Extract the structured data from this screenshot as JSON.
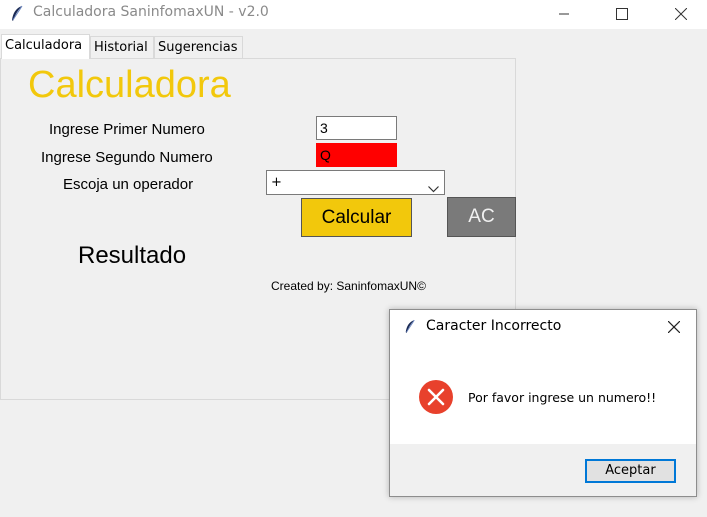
{
  "window": {
    "title": "Calculadora SaninfomaxUN - v2.0",
    "controls": {
      "minimize_icon": "minimize-icon",
      "maximize_icon": "maximize-icon",
      "close_icon": "close-icon"
    }
  },
  "tabs": [
    {
      "label": "Calculadora",
      "active": true
    },
    {
      "label": "Historial",
      "active": false
    },
    {
      "label": "Sugerencias",
      "active": false
    }
  ],
  "calculator": {
    "title": "Calculadora",
    "first_label": "Ingrese Primer Numero",
    "first_value": "3",
    "second_label": "Ingrese Segundo Numero",
    "second_value": "Q",
    "operator_label": "Escoja un operador",
    "operator_value": "+",
    "calc_button": "Calcular",
    "clear_button": "AC",
    "result_label": "Resultado",
    "credits": "Created by: SaninfomaxUN©"
  },
  "dialog": {
    "title": "Caracter Incorrecto",
    "message": "Por favor ingrese un numero!!",
    "ok_button": "Aceptar",
    "icon": "error-icon"
  },
  "colors": {
    "accent_yellow": "#f2c80c",
    "error_field": "#ff0000",
    "ac_button": "#7a7a7a",
    "error_icon": "#e8412c",
    "focus_border": "#0078d7"
  }
}
